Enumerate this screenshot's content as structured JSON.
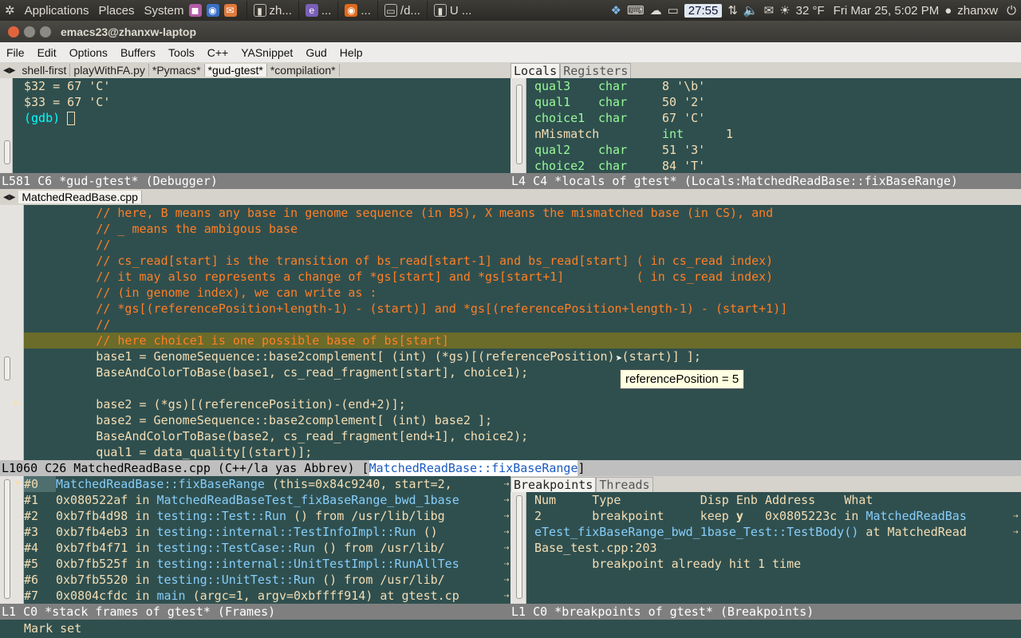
{
  "topbar": {
    "menus": [
      "Applications",
      "Places",
      "System"
    ],
    "tasks": [
      "zh...",
      "...",
      "...",
      "/d...",
      "U ..."
    ],
    "clock_badge": "27:55",
    "weather": "32 °F",
    "datetime": "Fri Mar 25,  5:02 PM",
    "user": "zhanxw",
    "icons": [
      "ubuntu-logo-icon",
      "firefox-icon",
      "mail-icon",
      "terminal-icon",
      "dropbox-icon",
      "keyboard-icon",
      "weather-icon",
      "battery-icon",
      "network-icon",
      "volume-icon",
      "envelope-icon",
      "sun-icon",
      "user-icon",
      "power-icon"
    ]
  },
  "window": {
    "title": "emacs23@zhanxw-laptop"
  },
  "menubar": {
    "items": [
      "File",
      "Edit",
      "Options",
      "Buffers",
      "Tools",
      "C++",
      "YASnippet",
      "Gud",
      "Help"
    ]
  },
  "gud": {
    "tabs": [
      "shell-first",
      "playWithFA.py",
      "*Pymacs*",
      "*gud-gtest*",
      "*compilation*"
    ],
    "lines": [
      "$32 = 67 'C'",
      "$33 = 67 'C'",
      "(gdb) "
    ],
    "modeline": "L581 C6 *gud-gtest* (Debugger)"
  },
  "locals": {
    "tabs": [
      "Locals",
      "Registers"
    ],
    "rows": [
      {
        "name": "qual3",
        "type": "char",
        "value": "8 '\\b'"
      },
      {
        "name": "qual1",
        "type": "char",
        "value": "50 '2'"
      },
      {
        "name": "choice1",
        "type": "char",
        "value": "67 'C'"
      },
      {
        "name": "nMismatch",
        "type": "int",
        "value": "1"
      },
      {
        "name": "qual2",
        "type": "char",
        "value": "51 '3'"
      },
      {
        "name": "choice2",
        "type": "char",
        "value": "84 'T'"
      }
    ],
    "modeline": "L4 C4 *locals of gtest* (Locals:MatchedReadBase::fixBaseRange)"
  },
  "source": {
    "tab": "MatchedReadBase.cpp",
    "lines": [
      "          // here, B means any base in genome sequence (in BS), X means the mismatched base (in CS), and",
      "          // _ means the ambigous base",
      "          //",
      "          // cs_read[start] is the transition of bs_read[start-1] and bs_read[start] ( in cs_read index)",
      "          // it may also represents a change of *gs[start] and *gs[start+1]          ( in cs_read index)",
      "          // (in genome index), we can write as :",
      "          // *gs[(referencePosition+length-1) - (start)] and *gs[(referencePosition+length-1) - (start+1)]",
      "          //",
      "          // here choice1 is one possible base of bs[start]",
      "          base1 = GenomeSequence::base2complement[ (int) (*gs)[(referencePosition)-(start)] ];",
      "          BaseAndColorToBase(base1, cs_read_fragment[start], choice1);",
      "",
      "          base2 = (*gs)[(referencePosition)-(end+2)];",
      "          base2 = GenomeSequence::base2complement[ (int) base2 ];",
      "          BaseAndColorToBase(base2, cs_read_fragment[end+1], choice2);",
      "          qual1 = data_quality[(start)];"
    ],
    "tooltip": "referencePosition = 5",
    "modeline_prefix": "L1060 C26 MatchedReadBase.cpp (C++/la yas Abbrev) [",
    "modeline_func": "MatchedReadBase::fixBaseRange",
    "modeline_suffix": "]"
  },
  "frames": {
    "rows": [
      {
        "num": "#0",
        "addr": "",
        "func": "MatchedReadBase::fixBaseRange",
        "rest": " (this=0x84c9240, start=2,"
      },
      {
        "num": "#1",
        "addr": "0x080522af in ",
        "func": "MatchedReadBaseTest_fixBaseRange_bwd_1base",
        "rest": ""
      },
      {
        "num": "#2",
        "addr": "0xb7fb4d98 in ",
        "func": "testing::Test::Run",
        "rest": " () from /usr/lib/libg"
      },
      {
        "num": "#3",
        "addr": "0xb7fb4eb3 in ",
        "func": "testing::internal::TestInfoImpl::Run",
        "rest": " () "
      },
      {
        "num": "#4",
        "addr": "0xb7fb4f71 in ",
        "func": "testing::TestCase::Run",
        "rest": " () from /usr/lib/"
      },
      {
        "num": "#5",
        "addr": "0xb7fb525f in ",
        "func": "testing::internal::UnitTestImpl::RunAllTes",
        "rest": ""
      },
      {
        "num": "#6",
        "addr": "0xb7fb5520 in ",
        "func": "testing::UnitTest::Run",
        "rest": " () from /usr/lib/"
      },
      {
        "num": "#7",
        "addr": "0x0804cfdc in ",
        "func": "main",
        "rest": " (argc=1, argv=0xbffff914) at gtest.cp"
      }
    ],
    "modeline": "L1 C0 *stack frames of gtest* (Frames)"
  },
  "breakpoints": {
    "tabs": [
      "Breakpoints",
      "Threads"
    ],
    "header": "Num     Type           Disp Enb Address    What",
    "line1_prefix": "2       breakpoint     keep ",
    "line1_enb": "y",
    "line1_mid": "   0x0805223c in ",
    "line1_func": "MatchedReadBas",
    "line2_func": "eTest_fixBaseRange_bwd_1base_Test::TestBody()",
    "line2_rest": " at MatchedRead",
    "line3": "Base_test.cpp:203",
    "line4": "        breakpoint already hit 1 time",
    "modeline": "L1 C0 *breakpoints of gtest* (Breakpoints)"
  },
  "minibuffer": "Mark set"
}
